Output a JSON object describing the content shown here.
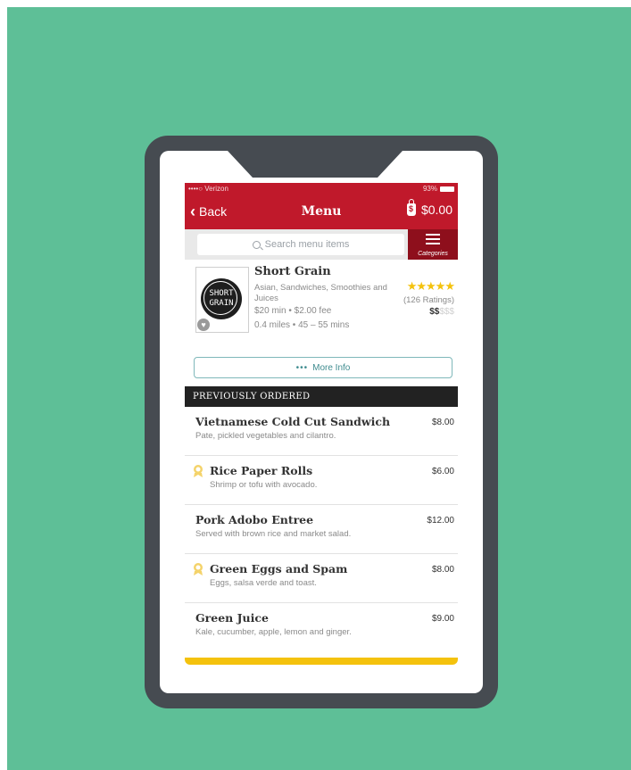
{
  "status": {
    "carrier": "••••○ Verizon",
    "battery": "93%"
  },
  "nav": {
    "back_label": "Back",
    "title": "Menu",
    "cart_total": "$0.00"
  },
  "search": {
    "placeholder": "Search menu items",
    "categories_label": "Categories"
  },
  "restaurant": {
    "name": "Short Grain",
    "logo_text_line1": "SHORT",
    "logo_text_line2": "GRAIN",
    "cuisine": "Asian, Sandwiches, Smoothies and Juices",
    "minimum": "$20 min • $2.00 fee",
    "distance": "0.4 miles • 45 – 55 mins",
    "rating_stars": "★★★★★",
    "ratings_count": "(126 Ratings)",
    "price_level_active": "$$",
    "price_level_inactive": "$$$"
  },
  "more_info_label": "More Info",
  "section_title": "PREVIOUSLY ORDERED",
  "items": [
    {
      "name": "Vietnamese Cold Cut Sandwich",
      "desc": "Pate, pickled vegetables and cilantro.",
      "price": "$8.00",
      "icon": ""
    },
    {
      "name": "Rice Paper Rolls",
      "desc": "Shrimp or tofu with avocado.",
      "price": "$6.00",
      "icon": "popular-icon"
    },
    {
      "name": "Pork Adobo Entree",
      "desc": "Served with brown rice and market salad.",
      "price": "$12.00",
      "icon": ""
    },
    {
      "name": "Green Eggs and Spam",
      "desc": "Eggs, salsa verde and toast.",
      "price": "$8.00",
      "icon": "popular-icon"
    },
    {
      "name": "Green Juice",
      "desc": "Kale, cucumber, apple, lemon and ginger.",
      "price": "$9.00",
      "icon": ""
    }
  ],
  "colors": {
    "background": "#5ebf97",
    "device": "#464b51",
    "brand_red": "#c0192b",
    "dark_red": "#8e0f1c",
    "accent_yellow": "#f4c20d",
    "teal": "#3f8c8f"
  }
}
